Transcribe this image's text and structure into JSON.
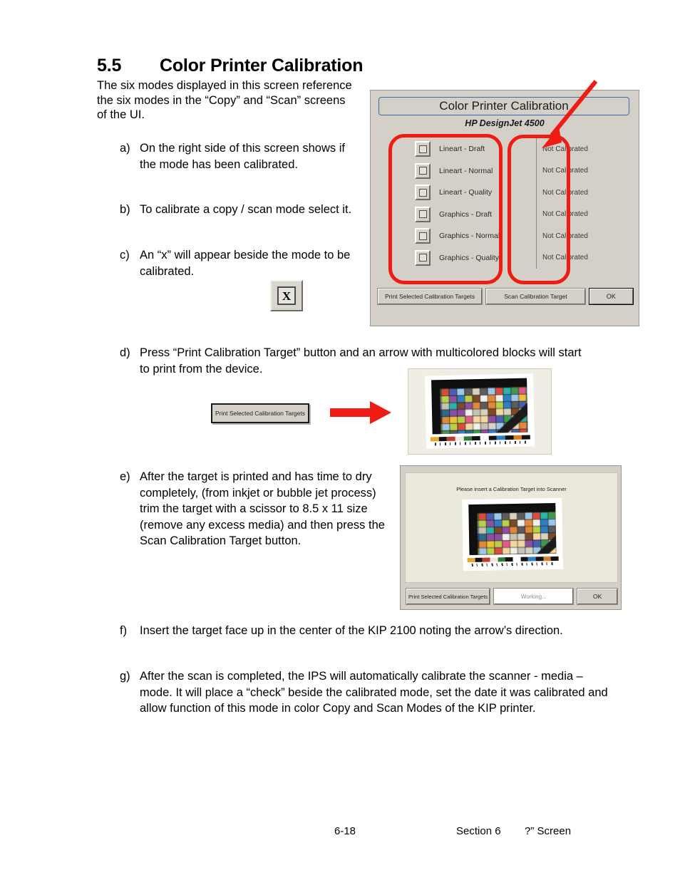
{
  "heading": {
    "number": "5.5",
    "title": "Color Printer Calibration"
  },
  "intro": "The six modes displayed in this screen reference the six modes in the “Copy” and “Scan” screens of the UI.",
  "steps": [
    {
      "mark": "a)",
      "text": "On the right side of this screen shows if the mode has been calibrated."
    },
    {
      "mark": "b)",
      "text": "To calibrate a copy / scan mode select it."
    },
    {
      "mark": "c)",
      "text": "An “x” will appear beside the mode to be calibrated."
    },
    {
      "mark": "d)",
      "text": "Press “Print Calibration Target” button and an arrow with multicolored blocks will start to print from the device."
    },
    {
      "mark": "e)",
      "text": "After the target is printed and has time to dry completely, (from inkjet or bubble jet process) trim the target with a scissor to 8.5 x 11 size (remove any excess media) and then press the Scan Calibration Target button."
    },
    {
      "mark": "f)",
      "text": "Insert the target face up in the center of the KIP 2100 noting the arrow’s direction."
    },
    {
      "mark": "g)",
      "text": "After the scan is completed, the IPS will automatically calibrate the scanner - media – mode. It will place a “check” beside the calibrated mode, set the date it was calibrated and allow function of this mode in color Copy and Scan Modes of the KIP printer."
    }
  ],
  "checkbox_figure": {
    "glyph": "X"
  },
  "dialog1": {
    "title": "Color Printer Calibration",
    "subtitle": "HP DesignJet 4500",
    "modes": [
      {
        "label": "Lineart - Draft",
        "status": "Not Calibrated",
        "checked": false
      },
      {
        "label": "Lineart - Normal",
        "status": "Not Calibrated",
        "checked": false
      },
      {
        "label": "Lineart - Quality",
        "status": "Not Calibrated",
        "checked": false
      },
      {
        "label": "Graphics - Draft",
        "status": "Not Calibrated",
        "checked": false
      },
      {
        "label": "Graphics - Normal",
        "status": "Not Calibrated",
        "checked": false
      },
      {
        "label": "Graphics - Quality",
        "status": "Not Calibrated",
        "checked": false
      }
    ],
    "buttons": {
      "print": "Print Selected Calibration Targets",
      "scan": "Scan Calibration Target",
      "ok": "OK"
    }
  },
  "print_button_figure": {
    "label": "Print Selected Calibration Targets"
  },
  "dialog2": {
    "prompt": "Please insert a Calibration Target into Scanner",
    "buttons": {
      "print": "Print Selected Calibration Targets",
      "working": "Working...",
      "ok": "OK"
    }
  },
  "footer": {
    "page": "6-18",
    "section": "Section 6",
    "screen": "?” Screen"
  },
  "colors": {
    "annotation_red": "#ee1c12",
    "dialog_face": "#d4d0c8",
    "title_border_blue": "#3b6cb8",
    "panel_cream": "#ebe9dc"
  }
}
